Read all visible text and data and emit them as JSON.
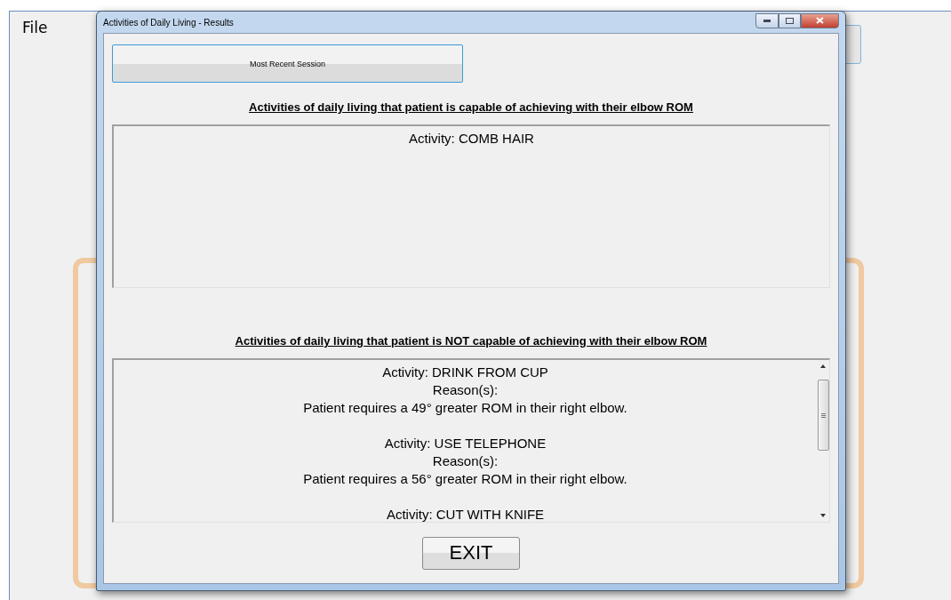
{
  "app": {
    "menu": [
      "File"
    ]
  },
  "dialog": {
    "title": "Activities of Daily Living - Results",
    "session_button": "Most Recent Session",
    "capable": {
      "heading": "Activities of daily living that patient is capable of achieving with their elbow ROM",
      "items": [
        {
          "activity": "Activity: COMB HAIR"
        }
      ]
    },
    "not_capable": {
      "heading": "Activities of daily living that patient is NOT capable of achieving with their elbow ROM",
      "items": [
        {
          "activity": "Activity: DRINK FROM CUP",
          "reason_label": "Reason(s):",
          "reason": "Patient requires a 49° greater ROM in their right elbow."
        },
        {
          "activity": "Activity: USE TELEPHONE",
          "reason_label": "Reason(s):",
          "reason": "Patient requires a 56° greater ROM in their right elbow."
        },
        {
          "activity": "Activity: CUT WITH KNIFE"
        }
      ]
    },
    "exit_button": "EXIT"
  }
}
